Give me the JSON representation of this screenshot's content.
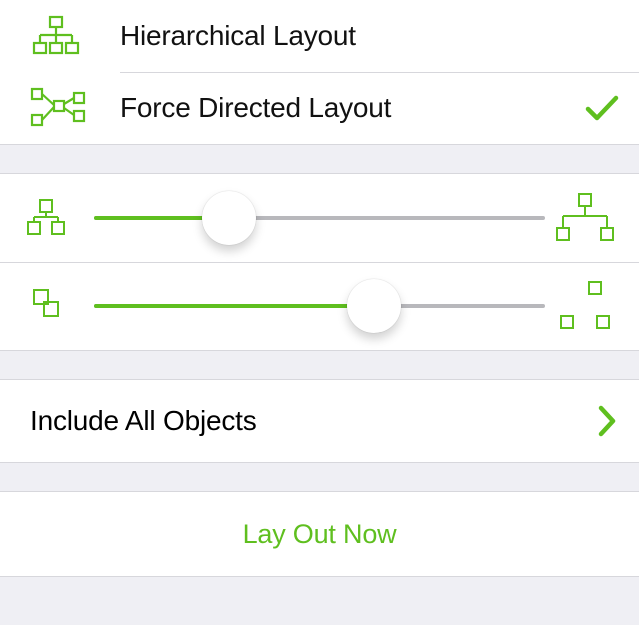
{
  "brand_color": "#5fbf1f",
  "layouts": {
    "options": [
      {
        "id": "hierarchical",
        "label": "Hierarchical Layout",
        "selected": false,
        "icon": "hierarchy-icon"
      },
      {
        "id": "force-directed",
        "label": "Force Directed Layout",
        "selected": true,
        "icon": "force-directed-icon"
      }
    ]
  },
  "sliders": {
    "spacing": {
      "id": "node-spacing-slider",
      "value": 30,
      "min": 0,
      "max": 100,
      "left_icon": "tree-compact-icon",
      "right_icon": "tree-spread-icon"
    },
    "distance": {
      "id": "cluster-distance-slider",
      "value": 62,
      "min": 0,
      "max": 100,
      "left_icon": "cluster-tight-icon",
      "right_icon": "cluster-loose-icon"
    }
  },
  "include": {
    "label": "Include All Objects"
  },
  "action": {
    "label": "Lay Out Now"
  }
}
